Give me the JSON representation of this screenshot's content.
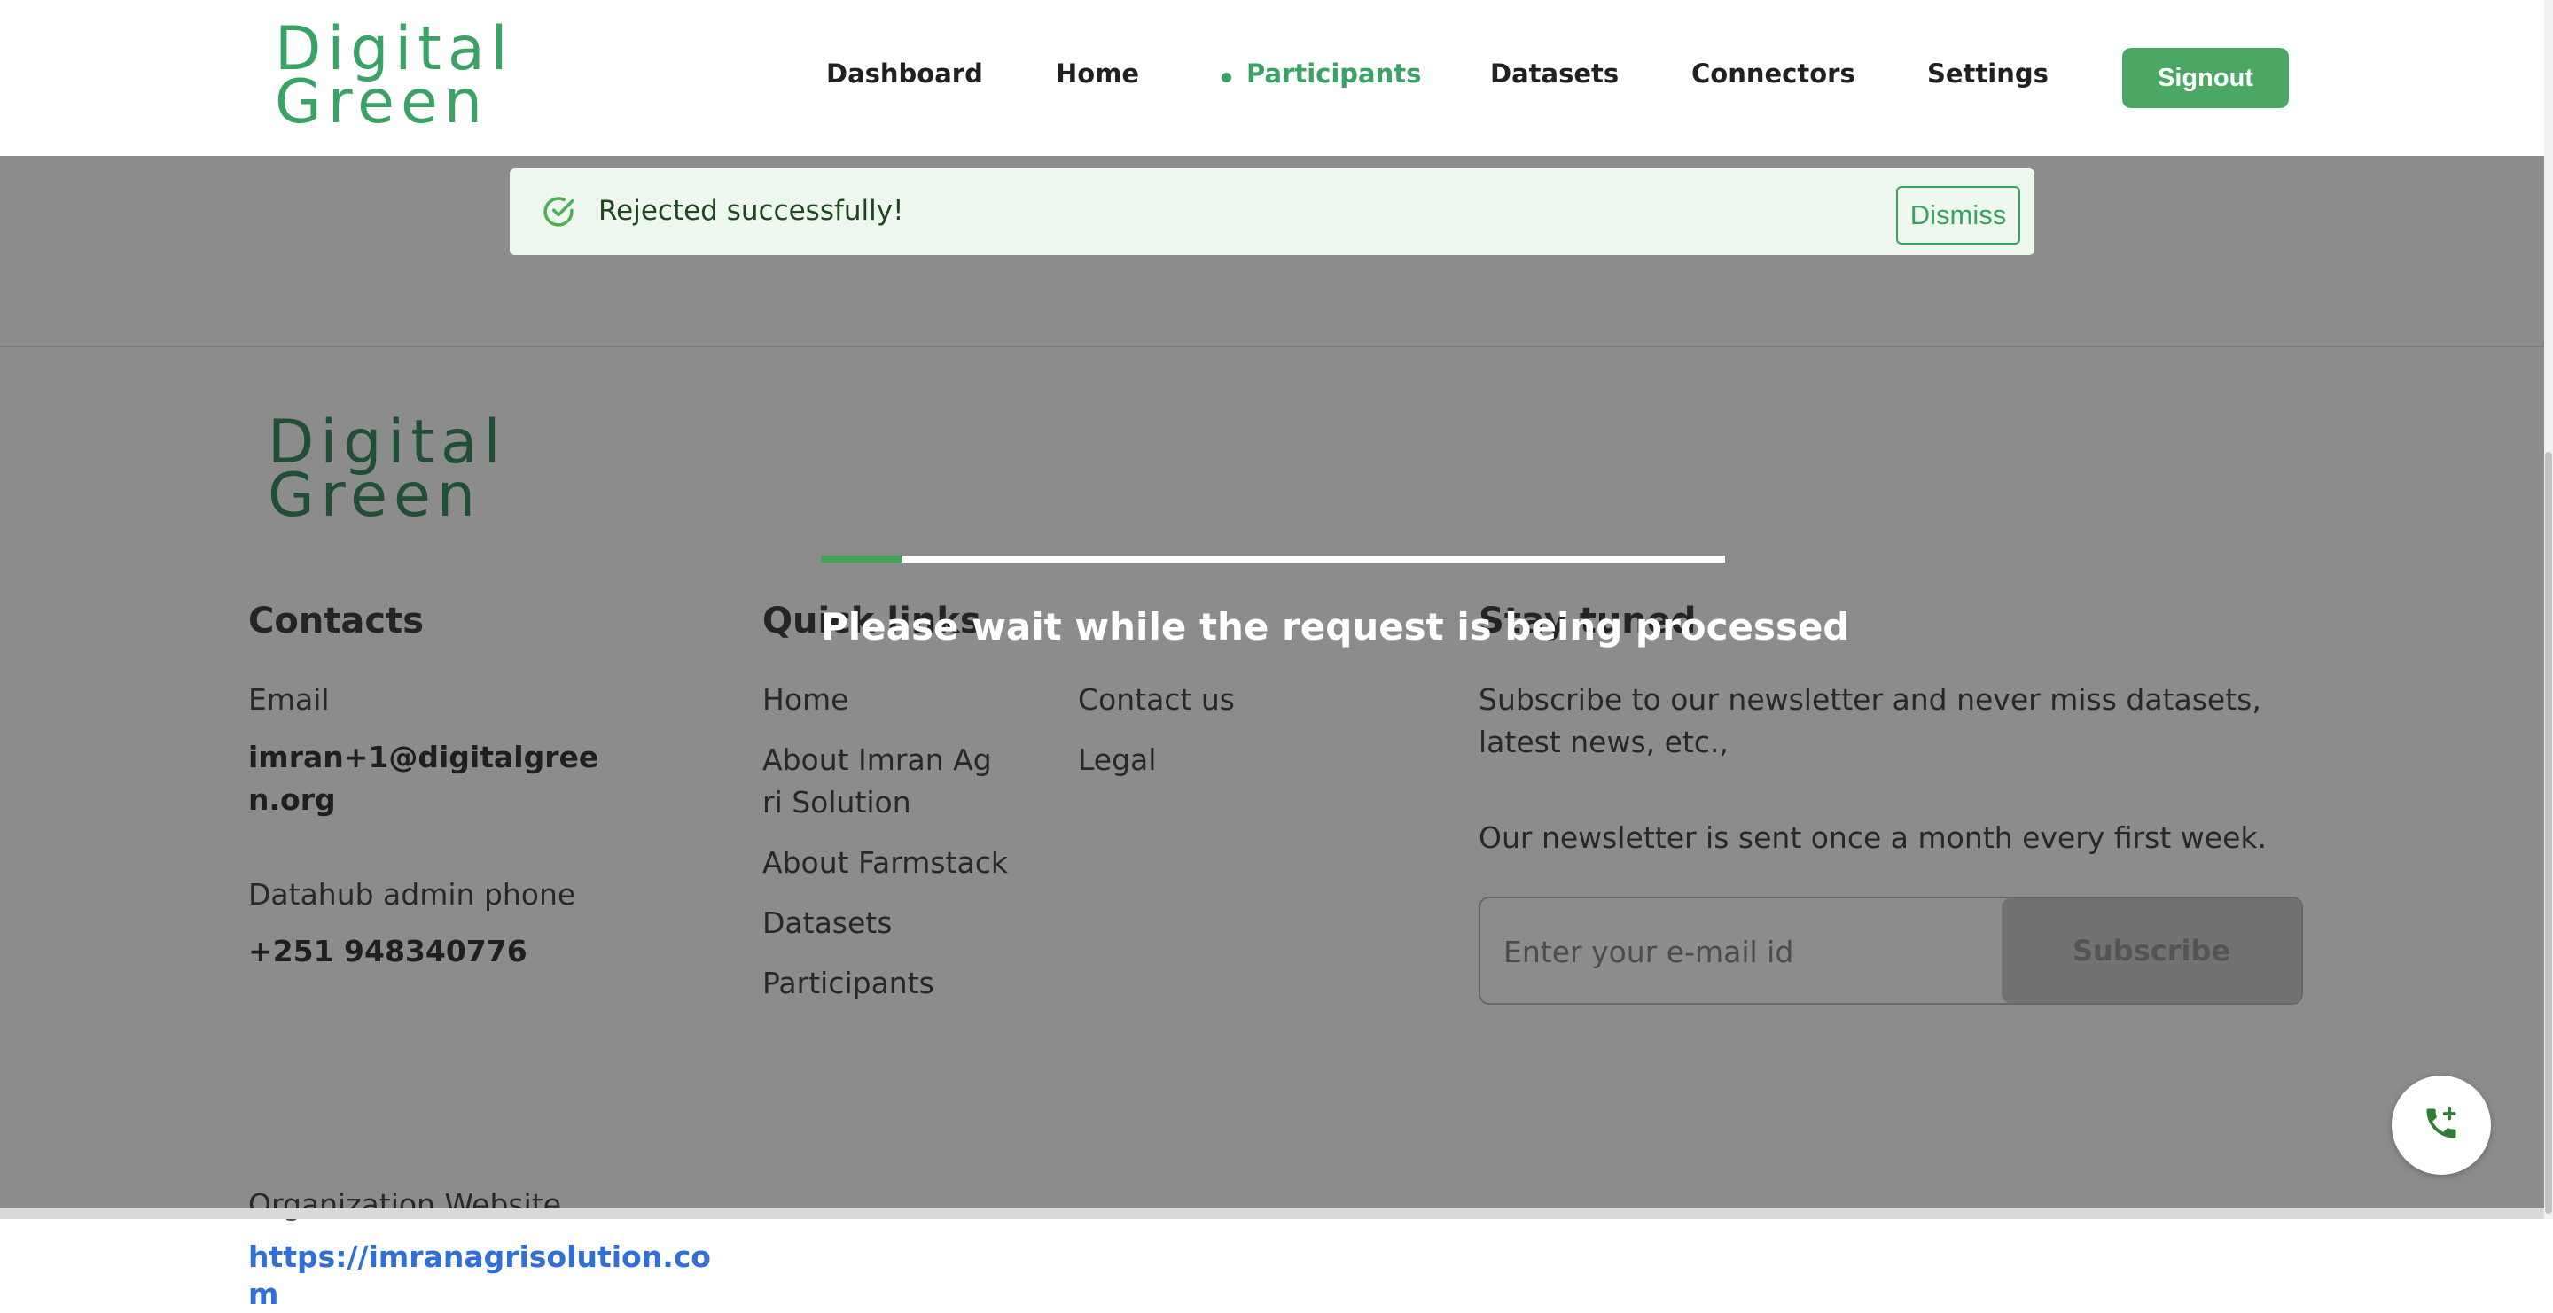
{
  "header": {
    "logo_line1": "Digital",
    "logo_line2": "Green",
    "nav": [
      {
        "label": "Dashboard"
      },
      {
        "label": "Home"
      },
      {
        "label": "Participants",
        "active": true
      },
      {
        "label": "Datasets"
      },
      {
        "label": "Connectors"
      },
      {
        "label": "Settings"
      }
    ],
    "signout_label": "Signout"
  },
  "toast": {
    "message": "Rejected successfully!",
    "dismiss_label": "Dismiss",
    "icon": "check-circle-icon"
  },
  "loading": {
    "message": "Please wait while the request is being processed",
    "progress": 0.09
  },
  "footer": {
    "logo_line1": "Digital",
    "logo_line2": "Green",
    "contacts": {
      "heading": "Contacts",
      "email_label": "Email",
      "email_line1": "imran+1@digitalgree",
      "email_line2": "n.org",
      "phone_label": "Datahub admin phone",
      "phone_value": "+251 948340776",
      "website_label": "Organization Website",
      "website_line1": "https://imranagrisolution.co",
      "website_line2": "m"
    },
    "quick_links": {
      "heading": "Quick links",
      "col1": [
        "Home",
        "About Imran Ag",
        "ri Solution",
        "About Farmstack",
        "Datasets",
        "Participants"
      ],
      "col2": [
        "Contact us",
        "Legal"
      ]
    },
    "stay_tuned": {
      "heading": "Stay tuned",
      "text_line1": "Subscribe to our newsletter and never miss datasets,",
      "text_line2": "latest news, etc.,",
      "text2": "Our newsletter is sent once a month every first week.",
      "email_placeholder": "Enter your e-mail id",
      "subscribe_label": "Subscribe"
    }
  },
  "colors": {
    "brand_green": "#3aa264",
    "overlay": "rgba(0,0,0,0.45)",
    "toast_bg": "#edf7ed"
  },
  "fab_icon": "phone-add-icon"
}
